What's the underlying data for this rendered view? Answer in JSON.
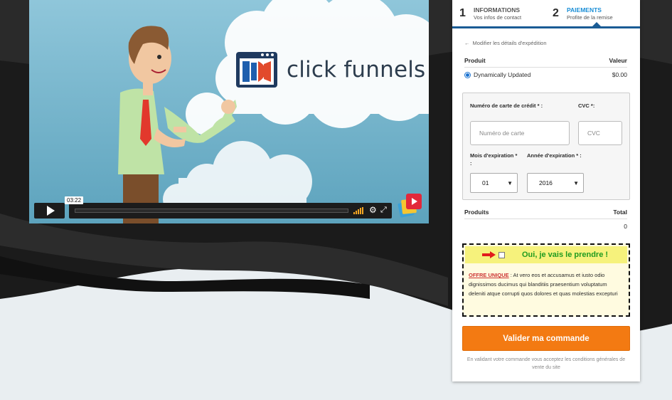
{
  "video": {
    "logo_text": "click funnels",
    "timecode": "03:22"
  },
  "steps": [
    {
      "num": "1",
      "title": "INFORMATIONS",
      "subtitle": "Vos infos de contact"
    },
    {
      "num": "2",
      "title": "PAIEMENTS",
      "subtitle": "Profite de la remise"
    }
  ],
  "back_link": "Modifier les détails d'expédition",
  "product_table": {
    "col_product": "Produit",
    "col_value": "Valeur",
    "row_name": "Dynamically Updated",
    "row_price": "$0.00"
  },
  "payment": {
    "card_label": "Numéro de carte de crédit * :",
    "card_placeholder": "Numéro de carte",
    "cvc_label": "CVC *:",
    "cvc_placeholder": "CVC",
    "month_label": "Mois d'expiration * :",
    "month_value": "01",
    "year_label": "Année d'expiration * :",
    "year_value": "2016"
  },
  "summary": {
    "col_products": "Produits",
    "col_total": "Total",
    "total_value": "0"
  },
  "bump": {
    "title": "Oui, je vais le prendre !",
    "offer_label": "OFFRE UNIQUE",
    "offer_text": " : At vero eos et accusamus et iusto odio dignissimos ducimus qui blanditiis praesentium voluptatum deleniti atque corrupti quos dolores et quas molestias excepturi"
  },
  "submit_label": "Valider ma commande",
  "terms_text": "En validant votre commande vous acceptez les conditions générales de vente du site",
  "colors": {
    "accent_blue": "#1a8ed6",
    "submit_orange": "#f37a12",
    "bump_green": "#1f9b1f",
    "highlight_red": "#e21b1b"
  }
}
